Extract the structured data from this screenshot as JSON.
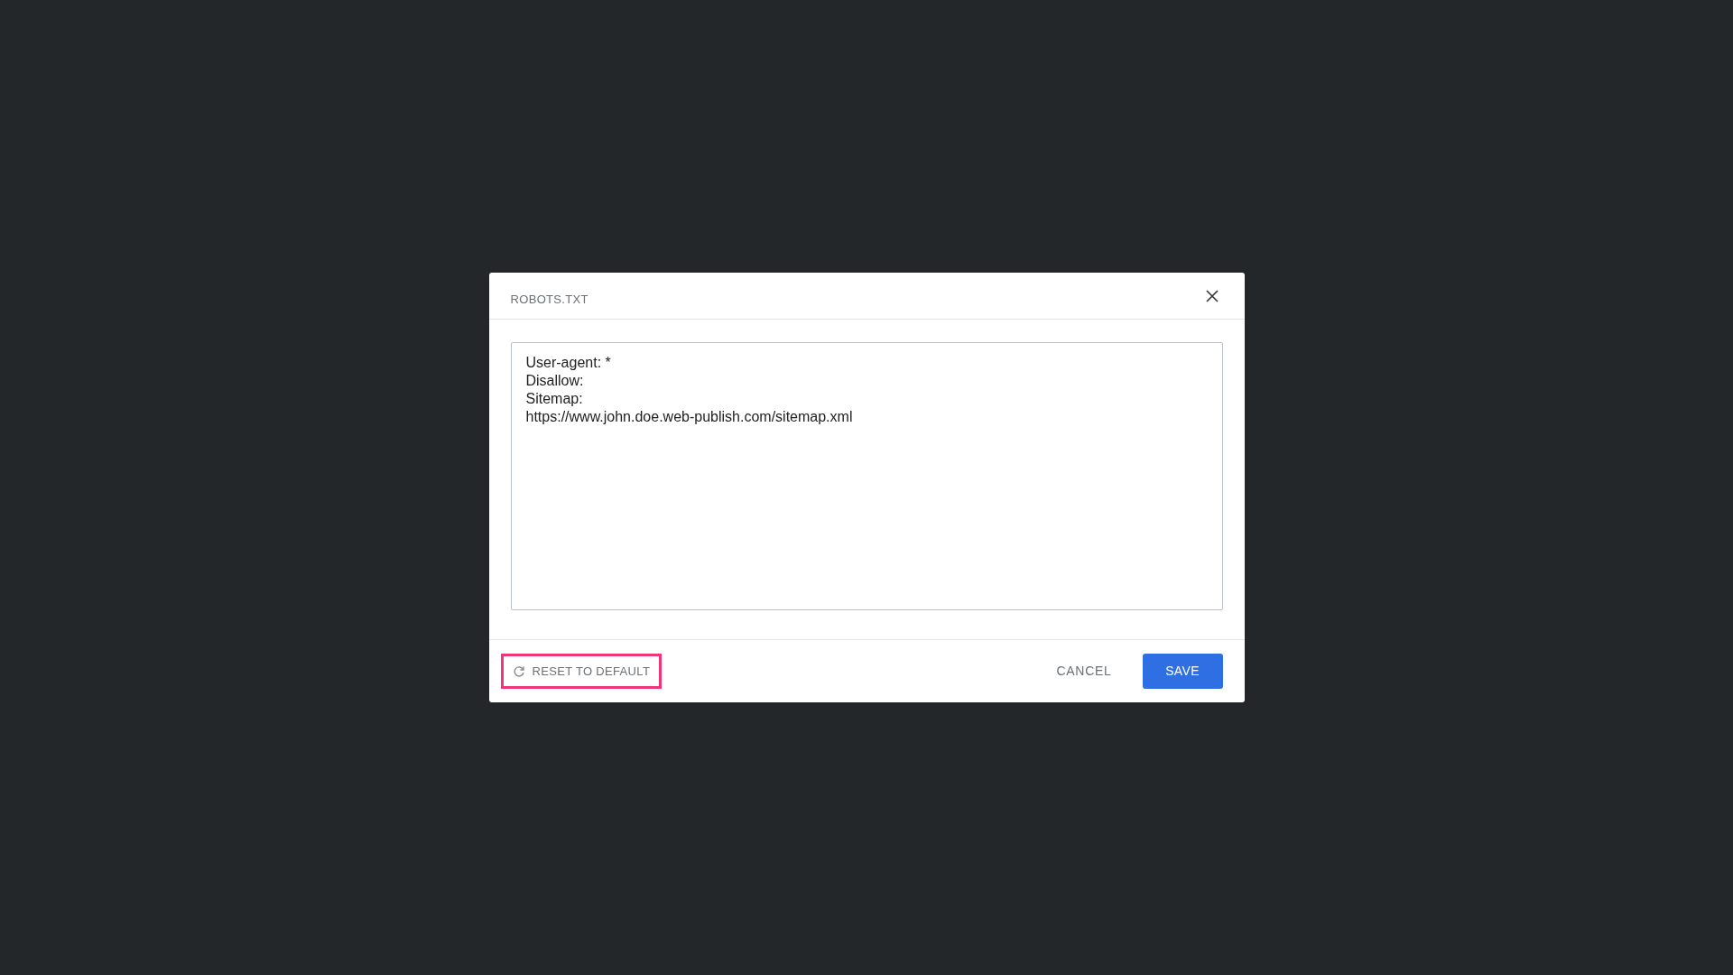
{
  "dialog": {
    "title": "ROBOTS.TXT",
    "editor": {
      "value": "User-agent: *\nDisallow:\nSitemap:\nhttps://www.john.doe.web-publish.com/sitemap.xml"
    },
    "reset_button": {
      "label": "RESET TO DEFAULT",
      "highlighted": true
    },
    "buttons": [
      {
        "label": "CANCEL",
        "kind": "text"
      },
      {
        "label": "SAVE",
        "kind": "primary"
      }
    ]
  }
}
